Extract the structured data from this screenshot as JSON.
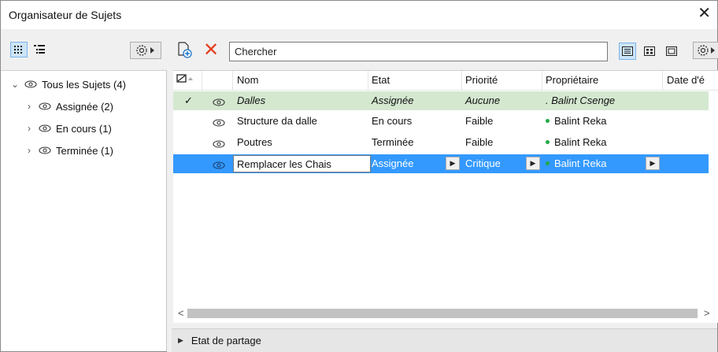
{
  "window": {
    "title": "Organisateur de Sujets",
    "close_glyph": "✕"
  },
  "left": {
    "tree": [
      {
        "label": "Tous les Sujets (4)",
        "expanded": true,
        "level": 0
      },
      {
        "label": "Assignée (2)",
        "expanded": false,
        "level": 1
      },
      {
        "label": "En cours (1)",
        "expanded": false,
        "level": 1
      },
      {
        "label": "Terminée (1)",
        "expanded": false,
        "level": 1
      }
    ]
  },
  "toolbar": {
    "delete_glyph": "✕",
    "search_value": "Chercher"
  },
  "table": {
    "headers": {
      "nom": "Nom",
      "etat": "Etat",
      "priorite": "Priorité",
      "proprietaire": "Propriétaire",
      "date": "Date d'é"
    },
    "rows": [
      {
        "check": "✓",
        "nom": "Dalles",
        "etat": "Assignée",
        "priorite": "Aucune",
        "proprietaire": ". Balint Csenge",
        "state": "active"
      },
      {
        "check": "",
        "nom": "Structure da dalle",
        "etat": "En cours",
        "priorite": "Faible",
        "proprietaire": "Balint Reka",
        "state": "normal"
      },
      {
        "check": "",
        "nom": "Poutres",
        "etat": "Terminée",
        "priorite": "Faible",
        "proprietaire": "Balint Reka",
        "state": "normal"
      },
      {
        "check": "",
        "nom": "Remplacer les Chais",
        "etat": "Assignée",
        "priorite": "Critique",
        "proprietaire": "Balint Reka",
        "state": "selected"
      }
    ]
  },
  "bottom": {
    "label": "Etat de partage"
  },
  "colors": {
    "selection": "#3399ff",
    "active_row": "#d4e8d0",
    "delete_red": "#e53e1e",
    "owner_dot": "#22aa44"
  }
}
